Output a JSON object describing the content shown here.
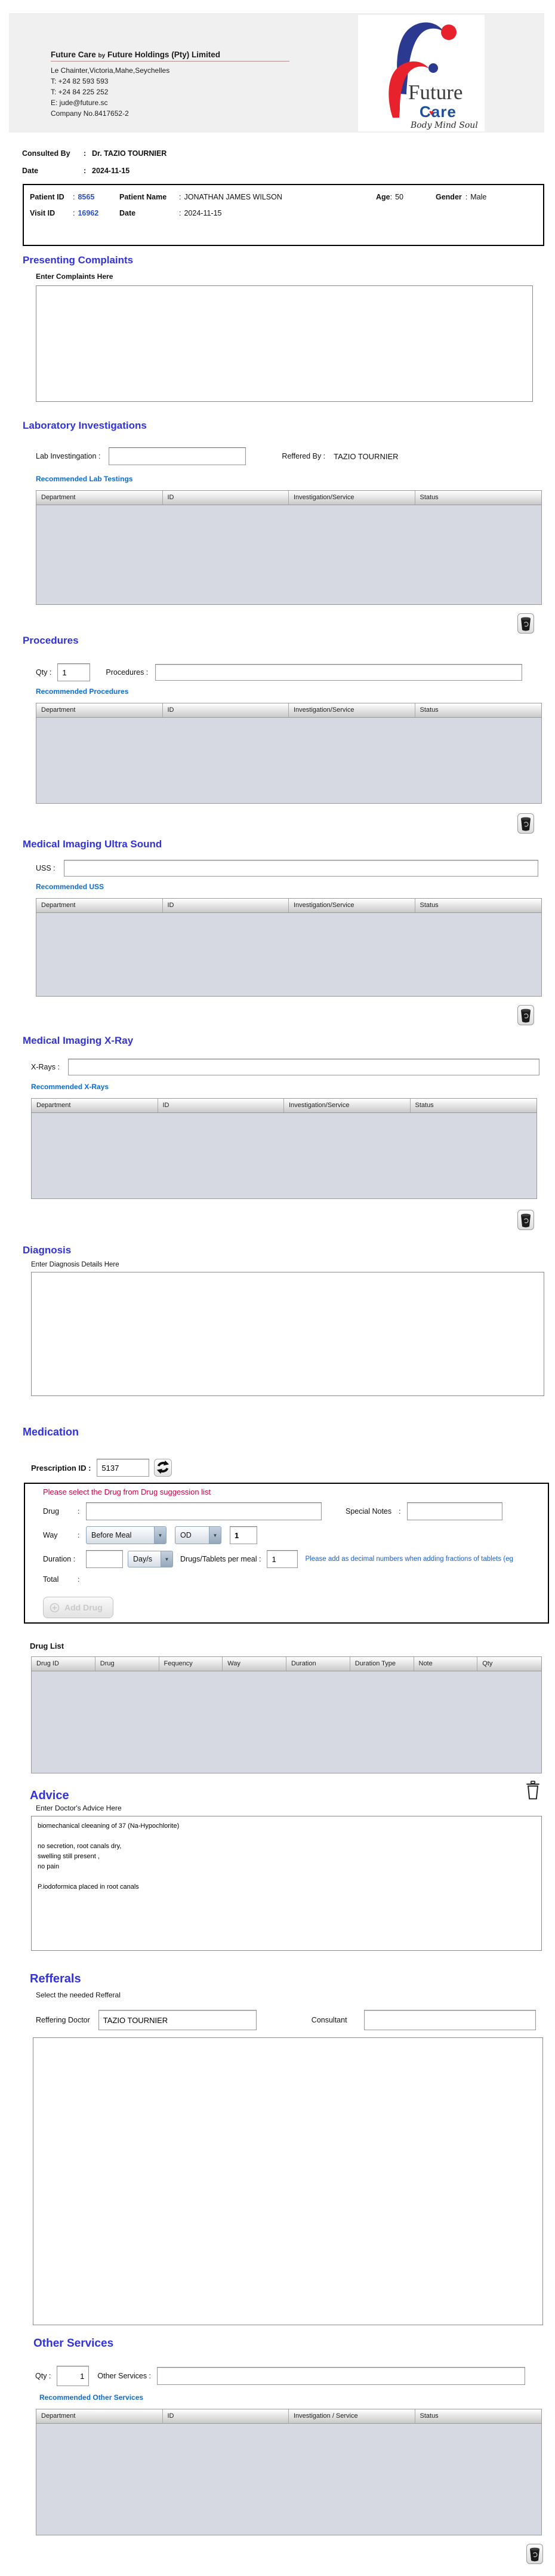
{
  "ui": {
    "colon": ":",
    "dropdown_arrow": "▼"
  },
  "colors": {
    "heading_blue": "#3232dd",
    "link_blue": "#0c6cd4",
    "warning_red": "#cc0044",
    "note_blue": "#1a5fd6",
    "id_blue": "#2d4fc8",
    "table_body_gray": "#d6d9e1"
  },
  "icons": {
    "trash": "trash-can",
    "trash_outline": "trash-can-outline",
    "refresh": "refresh-arrows",
    "add": "plus-circle"
  },
  "header": {
    "title_pre": "Future Care ",
    "title_by": "by",
    "title_post": " Future Holdings (Pty) Limited",
    "address": "Le Chainter,Victoria,Mahe,Seychelles",
    "phone1": "T: +24  82 593 593",
    "phone2": "T: +24  84 225 252",
    "email": "E: jude@future.sc",
    "company_no": "Company No.8417652-2",
    "logo_line1": "Future",
    "logo_line2": "Care",
    "logo_heart": "♥",
    "logo_tagline": "Body Mind Soul"
  },
  "consultation": {
    "consulted_by_label": "Consulted By",
    "consulted_by_value": "Dr.  TAZIO TOURNIER",
    "date_label": "Date",
    "date_value": "2024-11-15"
  },
  "patient": {
    "patient_id_label": "Patient ID",
    "patient_id": "8565",
    "patient_name_label": "Patient Name",
    "patient_name": "JONATHAN JAMES WILSON",
    "age_label": "Age",
    "age": "50",
    "gender_label": "Gender",
    "gender": "Male",
    "visit_id_label": "Visit ID",
    "visit_id": "16962",
    "date_label": "Date",
    "visit_date": "2024-11-15"
  },
  "complaints": {
    "title": "Presenting Complaints",
    "label": "Enter Complaints Here",
    "value": ""
  },
  "laboratory": {
    "title": "Laboratory  Investigations",
    "input_label": "Lab Investingation :",
    "input_value": "",
    "referred_by_label": "Reffered By :",
    "referred_by_value": "TAZIO TOURNIER",
    "recommended_label": "Recommended Lab Testings",
    "headers": [
      "Department",
      "ID",
      "Investigation/Service",
      "Status"
    ]
  },
  "procedures": {
    "title": "Procedures",
    "qty_label": "Qty :",
    "qty_value": "1",
    "input_label": "Procedures :",
    "input_value": "",
    "recommended_label": "Recommended Procedures",
    "headers": [
      "Department",
      "ID",
      "Investigation/Service",
      "Status"
    ]
  },
  "ultrasound": {
    "title": "Medical Imaging Ultra Sound",
    "input_label": "USS :",
    "input_value": "",
    "recommended_label": "Recommended USS",
    "headers": [
      "Department",
      "ID",
      "Investigation/Service",
      "Status"
    ]
  },
  "xray": {
    "title": "Medical Imaging X-Ray",
    "input_label": "X-Rays :",
    "input_value": "",
    "recommended_label": "Recommended X-Rays",
    "headers": [
      "Department",
      "ID",
      "Investigation/Service",
      "Status"
    ]
  },
  "diagnosis": {
    "title": "Diagnosis",
    "label": "Enter Diagnosis Details Here",
    "value": ""
  },
  "medication": {
    "title": "Medication",
    "prescription_id_label": "Prescription ID :",
    "prescription_id": "5137",
    "warning": "Please select the Drug from Drug suggession list",
    "drug_label": "Drug",
    "drug_value": "",
    "special_notes_label": "Special Notes",
    "special_notes_value": "",
    "way_label": "Way",
    "meal_select_value": "Before Meal",
    "frequency_select_value": "OD",
    "way_qty_value": "1",
    "duration_label": "Duration :",
    "duration_value": "",
    "duration_type_value": "Day/s",
    "per_meal_label": "Drugs/Tablets per meal :",
    "per_meal_value": "1",
    "note": "Please add as decimal numbers when adding fractions of tablets (eg",
    "total_label": "Total",
    "add_drug_label": "Add Drug",
    "drug_list_label": "Drug List",
    "headers": [
      "Drug ID",
      "Drug",
      "Fequency",
      "Way",
      "Duration",
      "Duration Type",
      "Note",
      "Qty"
    ]
  },
  "advice": {
    "title": "Advice",
    "label": "Enter Doctor's Advice Here",
    "value": "biomechanical cleeaning of 37 (Na-Hypochlorite)\n\nno secretion, root canals dry,\nswelling still present ,\nno pain\n\nP.iodoformica placed in root canals"
  },
  "referrals": {
    "title": "Refferals",
    "subtitle": "Select the needed Refferal",
    "doctor_label": "Reffering Doctor",
    "doctor_value": "TAZIO TOURNIER",
    "consultant_label": "Consultant",
    "consultant_value": ""
  },
  "other_services": {
    "title": "Other Services",
    "qty_label": "Qty :",
    "qty_value": "1",
    "input_label": "Other Services :",
    "input_value": "",
    "recommended_label": "Recommended Other Services",
    "headers": [
      "Department",
      "ID",
      "Investigation / Service",
      "Status"
    ]
  }
}
